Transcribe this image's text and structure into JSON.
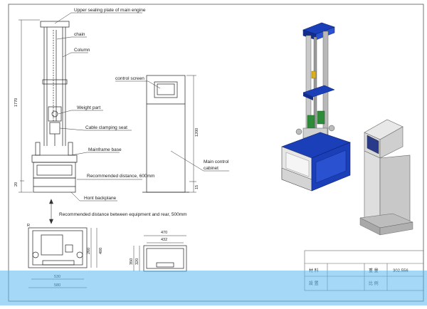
{
  "labels": {
    "upper_plate": "Upper sealing plate of main engine",
    "chain": "chain",
    "column": "Column",
    "weight_part": "Weight part",
    "cable_seat": "Cable clamping seat",
    "mainframe_base": "Mainframe base",
    "recommended_distance": "Recommended distance, 600mm",
    "front_backplane": "Hont backplane",
    "rear_distance": "Recommended distance between equipment and rear, 500mm",
    "control_screen": "control screen",
    "main_cabinet_1": "Main control",
    "main_cabinet_2": "cabinet"
  },
  "dimensions": {
    "height_main": "1770",
    "height_base": "20",
    "cabinet_height": "1200",
    "cabinet_base": "15",
    "plan_depth_1": "260",
    "plan_depth_2": "400",
    "plan_width_inner": "530",
    "plan_width_outer": "580",
    "cab_plan_width_outer": "470",
    "cab_plan_width_inner": "432",
    "cab_plan_depth_1": "320",
    "cab_plan_depth_2": "350",
    "plan_marker": "R"
  },
  "title_block": {
    "material_label": "材 料",
    "material_value": "",
    "weight_label": "重 量",
    "weight_value": "302.556",
    "design_label": "設 置",
    "scale_label": "比 例"
  }
}
